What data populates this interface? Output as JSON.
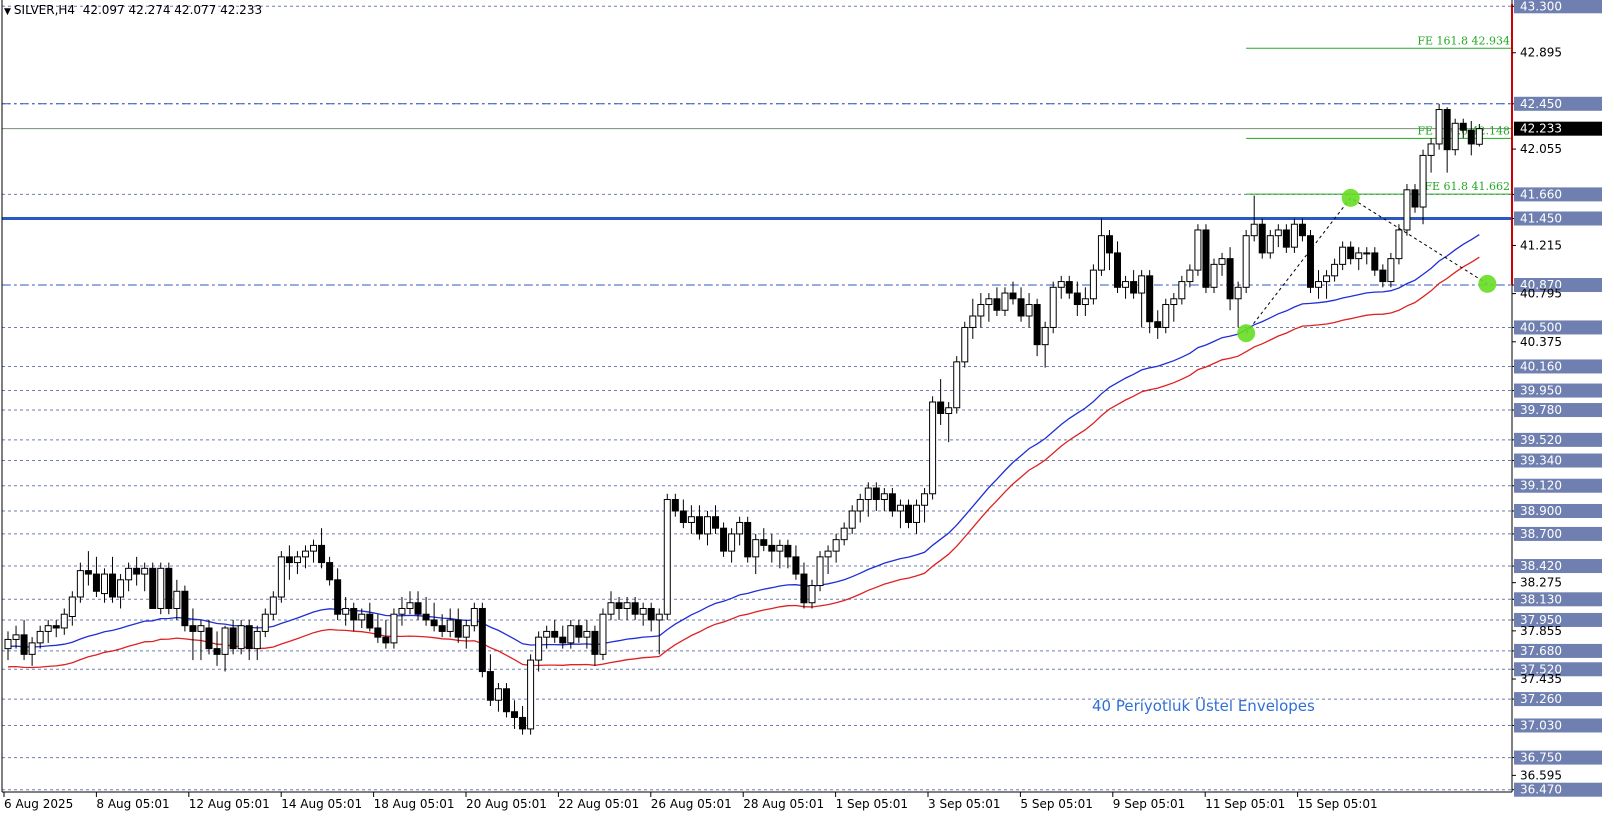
{
  "header": {
    "symbol": "SILVER,H4",
    "ohlc": "42.097 42.274 42.077 42.233"
  },
  "annotation": "40 Periyotluk Üstel Envelopes",
  "chart_data": {
    "type": "candlestick",
    "ylim": [
      36.45,
      43.32
    ],
    "current_price": 42.233,
    "price_axis_labels": [
      43.3,
      42.895,
      42.45,
      42.055,
      41.66,
      41.45,
      41.215,
      40.87,
      40.795,
      40.5,
      40.375,
      40.16,
      39.95,
      39.78,
      39.52,
      39.34,
      39.12,
      38.9,
      38.7,
      38.42,
      38.275,
      38.13,
      37.95,
      37.855,
      37.68,
      37.52,
      37.435,
      37.26,
      37.03,
      36.75,
      36.595,
      36.47
    ],
    "highlighted_levels": [
      43.3,
      42.45,
      41.66,
      41.45,
      40.87,
      40.5,
      40.16,
      39.95,
      39.78,
      39.52,
      39.34,
      39.12,
      38.9,
      38.7,
      38.42,
      38.13,
      37.95,
      37.68,
      37.52,
      37.26,
      37.03,
      36.75,
      36.47
    ],
    "time_labels": [
      "6 Aug 2025",
      "8 Aug 05:01",
      "12 Aug 05:01",
      "14 Aug 05:01",
      "18 Aug 05:01",
      "20 Aug 05:01",
      "22 Aug 05:01",
      "26 Aug 05:01",
      "28 Aug 05:01",
      "1 Sep 05:01",
      "3 Sep 05:01",
      "5 Sep 05:01",
      "9 Sep 05:01",
      "11 Sep 05:01",
      "15 Sep 05:01"
    ],
    "support_line": 41.45,
    "dash_dot_levels": [
      42.45,
      40.87
    ],
    "fibonacci": [
      {
        "label": "FE 161.8 42.934",
        "value": 42.934
      },
      {
        "label": "FE 100.0 42.148",
        "value": 42.148
      },
      {
        "label": "FE 61.8 41.662",
        "value": 41.662
      }
    ],
    "pattern_points": [
      {
        "index": 154,
        "price": 40.45
      },
      {
        "index": 167,
        "price": 41.63
      },
      {
        "index": 184,
        "price": 40.88
      }
    ],
    "candles": [
      [
        37.7,
        37.85,
        37.6,
        37.78
      ],
      [
        37.78,
        37.9,
        37.7,
        37.82
      ],
      [
        37.82,
        37.95,
        37.6,
        37.65
      ],
      [
        37.65,
        37.8,
        37.55,
        37.75
      ],
      [
        37.75,
        37.9,
        37.7,
        37.85
      ],
      [
        37.85,
        37.95,
        37.75,
        37.9
      ],
      [
        37.9,
        37.95,
        37.8,
        37.88
      ],
      [
        37.88,
        38.05,
        37.82,
        38.0
      ],
      [
        37.98,
        38.2,
        37.9,
        38.15
      ],
      [
        38.15,
        38.45,
        38.1,
        38.38
      ],
      [
        38.38,
        38.55,
        38.25,
        38.35
      ],
      [
        38.35,
        38.5,
        38.15,
        38.2
      ],
      [
        38.18,
        38.4,
        38.1,
        38.35
      ],
      [
        38.35,
        38.5,
        38.1,
        38.15
      ],
      [
        38.15,
        38.35,
        38.05,
        38.3
      ],
      [
        38.3,
        38.45,
        38.2,
        38.4
      ],
      [
        38.4,
        38.5,
        38.25,
        38.35
      ],
      [
        38.35,
        38.45,
        38.2,
        38.4
      ],
      [
        38.4,
        38.45,
        38.05,
        38.05
      ],
      [
        38.05,
        38.45,
        38.0,
        38.4
      ],
      [
        38.4,
        38.45,
        38.0,
        38.05
      ],
      [
        38.05,
        38.3,
        37.95,
        38.2
      ],
      [
        38.2,
        38.25,
        37.85,
        37.9
      ],
      [
        37.9,
        38.05,
        37.6,
        37.85
      ],
      [
        37.85,
        37.95,
        37.6,
        37.9
      ],
      [
        37.88,
        37.95,
        37.65,
        37.7
      ],
      [
        37.7,
        37.85,
        37.55,
        37.65
      ],
      [
        37.65,
        37.9,
        37.5,
        37.88
      ],
      [
        37.88,
        37.95,
        37.65,
        37.7
      ],
      [
        37.7,
        37.95,
        37.65,
        37.9
      ],
      [
        37.9,
        37.95,
        37.6,
        37.7
      ],
      [
        37.7,
        37.9,
        37.6,
        37.85
      ],
      [
        37.85,
        38.05,
        37.8,
        38.0
      ],
      [
        38.0,
        38.2,
        37.95,
        38.15
      ],
      [
        38.15,
        38.55,
        38.1,
        38.5
      ],
      [
        38.5,
        38.6,
        38.3,
        38.45
      ],
      [
        38.45,
        38.55,
        38.35,
        38.5
      ],
      [
        38.5,
        38.6,
        38.4,
        38.55
      ],
      [
        38.55,
        38.65,
        38.45,
        38.6
      ],
      [
        38.6,
        38.75,
        38.4,
        38.45
      ],
      [
        38.45,
        38.5,
        38.25,
        38.3
      ],
      [
        38.3,
        38.4,
        37.95,
        38.0
      ],
      [
        38.0,
        38.15,
        37.9,
        38.05
      ],
      [
        38.05,
        38.1,
        37.85,
        37.95
      ],
      [
        37.95,
        38.05,
        37.88,
        38.0
      ],
      [
        38.0,
        38.1,
        37.85,
        37.88
      ],
      [
        37.88,
        38.0,
        37.75,
        37.8
      ],
      [
        37.8,
        37.95,
        37.7,
        37.75
      ],
      [
        37.75,
        38.05,
        37.7,
        38.0
      ],
      [
        38.0,
        38.15,
        37.9,
        38.05
      ],
      [
        38.05,
        38.2,
        38.0,
        38.1
      ],
      [
        38.1,
        38.2,
        37.95,
        38.0
      ],
      [
        38.0,
        38.15,
        37.9,
        37.95
      ],
      [
        37.95,
        38.1,
        37.85,
        37.9
      ],
      [
        37.9,
        38.0,
        37.8,
        37.85
      ],
      [
        37.85,
        38.05,
        37.8,
        37.95
      ],
      [
        37.95,
        38.05,
        37.75,
        37.8
      ],
      [
        37.8,
        37.95,
        37.7,
        37.9
      ],
      [
        37.9,
        38.1,
        37.85,
        38.05
      ],
      [
        38.05,
        38.1,
        37.45,
        37.5
      ],
      [
        37.5,
        37.65,
        37.2,
        37.25
      ],
      [
        37.25,
        37.4,
        37.15,
        37.35
      ],
      [
        37.35,
        37.4,
        37.1,
        37.15
      ],
      [
        37.15,
        37.25,
        37.0,
        37.1
      ],
      [
        37.1,
        37.2,
        36.95,
        37.0
      ],
      [
        37.0,
        37.65,
        36.95,
        37.6
      ],
      [
        37.6,
        37.85,
        37.5,
        37.8
      ],
      [
        37.8,
        37.9,
        37.7,
        37.85
      ],
      [
        37.85,
        37.95,
        37.75,
        37.8
      ],
      [
        37.8,
        37.9,
        37.7,
        37.75
      ],
      [
        37.75,
        37.95,
        37.7,
        37.9
      ],
      [
        37.9,
        37.95,
        37.75,
        37.8
      ],
      [
        37.8,
        37.95,
        37.7,
        37.85
      ],
      [
        37.85,
        37.9,
        37.55,
        37.65
      ],
      [
        37.65,
        38.05,
        37.6,
        38.0
      ],
      [
        38.0,
        38.2,
        37.95,
        38.1
      ],
      [
        38.1,
        38.15,
        37.95,
        38.05
      ],
      [
        38.05,
        38.15,
        37.95,
        38.1
      ],
      [
        38.1,
        38.15,
        37.95,
        38.0
      ],
      [
        38.0,
        38.1,
        37.9,
        38.05
      ],
      [
        38.05,
        38.1,
        37.85,
        37.95
      ],
      [
        37.95,
        38.05,
        37.65,
        38.0
      ],
      [
        38.0,
        39.05,
        37.95,
        39.0
      ],
      [
        39.0,
        39.05,
        38.85,
        38.9
      ],
      [
        38.9,
        39.0,
        38.75,
        38.8
      ],
      [
        38.8,
        38.95,
        38.7,
        38.85
      ],
      [
        38.85,
        38.95,
        38.65,
        38.7
      ],
      [
        38.7,
        38.9,
        38.6,
        38.85
      ],
      [
        38.85,
        38.95,
        38.7,
        38.75
      ],
      [
        38.75,
        38.8,
        38.5,
        38.55
      ],
      [
        38.55,
        38.75,
        38.45,
        38.7
      ],
      [
        38.7,
        38.85,
        38.6,
        38.8
      ],
      [
        38.8,
        38.85,
        38.45,
        38.5
      ],
      [
        38.5,
        38.7,
        38.35,
        38.65
      ],
      [
        38.65,
        38.75,
        38.55,
        38.6
      ],
      [
        38.6,
        38.7,
        38.45,
        38.55
      ],
      [
        38.55,
        38.65,
        38.4,
        38.6
      ],
      [
        38.6,
        38.65,
        38.4,
        38.5
      ],
      [
        38.5,
        38.6,
        38.3,
        38.35
      ],
      [
        38.35,
        38.45,
        38.05,
        38.1
      ],
      [
        38.1,
        38.3,
        38.05,
        38.25
      ],
      [
        38.25,
        38.55,
        38.2,
        38.5
      ],
      [
        38.5,
        38.6,
        38.35,
        38.55
      ],
      [
        38.55,
        38.7,
        38.45,
        38.65
      ],
      [
        38.65,
        38.8,
        38.6,
        38.75
      ],
      [
        38.75,
        38.95,
        38.7,
        38.9
      ],
      [
        38.9,
        39.05,
        38.8,
        39.0
      ],
      [
        39.0,
        39.15,
        38.85,
        39.1
      ],
      [
        39.1,
        39.15,
        38.9,
        39.0
      ],
      [
        39.0,
        39.1,
        38.9,
        39.05
      ],
      [
        39.05,
        39.1,
        38.85,
        38.9
      ],
      [
        38.9,
        39.0,
        38.75,
        38.95
      ],
      [
        38.95,
        39.0,
        38.75,
        38.8
      ],
      [
        38.8,
        39.0,
        38.7,
        38.95
      ],
      [
        38.95,
        39.1,
        38.8,
        39.05
      ],
      [
        39.05,
        39.9,
        39.0,
        39.85
      ],
      [
        39.85,
        40.05,
        39.65,
        39.75
      ],
      [
        39.75,
        39.85,
        39.5,
        39.8
      ],
      [
        39.8,
        40.25,
        39.75,
        40.2
      ],
      [
        40.2,
        40.55,
        40.15,
        40.5
      ],
      [
        40.5,
        40.75,
        40.4,
        40.6
      ],
      [
        40.6,
        40.8,
        40.5,
        40.7
      ],
      [
        40.7,
        40.8,
        40.55,
        40.75
      ],
      [
        40.75,
        40.85,
        40.6,
        40.65
      ],
      [
        40.65,
        40.85,
        40.6,
        40.8
      ],
      [
        40.8,
        40.9,
        40.7,
        40.75
      ],
      [
        40.75,
        40.85,
        40.55,
        40.6
      ],
      [
        40.6,
        40.8,
        40.5,
        40.7
      ],
      [
        40.7,
        40.75,
        40.25,
        40.35
      ],
      [
        40.35,
        40.55,
        40.15,
        40.5
      ],
      [
        40.5,
        40.9,
        40.45,
        40.85
      ],
      [
        40.85,
        40.95,
        40.75,
        40.9
      ],
      [
        40.9,
        40.95,
        40.75,
        40.8
      ],
      [
        40.8,
        40.9,
        40.6,
        40.7
      ],
      [
        40.7,
        40.85,
        40.6,
        40.75
      ],
      [
        40.75,
        41.05,
        40.7,
        41.0
      ],
      [
        41.0,
        41.45,
        40.95,
        41.3
      ],
      [
        41.3,
        41.35,
        41.0,
        41.15
      ],
      [
        41.15,
        41.25,
        40.8,
        40.85
      ],
      [
        40.85,
        40.95,
        40.75,
        40.9
      ],
      [
        40.9,
        41.0,
        40.75,
        40.8
      ],
      [
        40.8,
        41.0,
        40.5,
        40.95
      ],
      [
        40.95,
        41.0,
        40.45,
        40.55
      ],
      [
        40.55,
        40.65,
        40.4,
        40.5
      ],
      [
        40.5,
        40.75,
        40.45,
        40.7
      ],
      [
        40.7,
        40.8,
        40.55,
        40.75
      ],
      [
        40.75,
        40.95,
        40.7,
        40.9
      ],
      [
        40.9,
        41.05,
        40.85,
        41.0
      ],
      [
        41.0,
        41.4,
        40.95,
        41.35
      ],
      [
        41.35,
        41.4,
        40.8,
        40.85
      ],
      [
        40.85,
        41.1,
        40.8,
        41.05
      ],
      [
        41.05,
        41.15,
        40.95,
        41.1
      ],
      [
        41.1,
        41.2,
        40.65,
        40.75
      ],
      [
        40.75,
        40.9,
        40.5,
        40.85
      ],
      [
        40.85,
        41.35,
        40.8,
        41.3
      ],
      [
        41.3,
        41.65,
        41.25,
        41.4
      ],
      [
        41.4,
        41.45,
        41.1,
        41.15
      ],
      [
        41.15,
        41.35,
        41.1,
        41.3
      ],
      [
        41.3,
        41.4,
        41.2,
        41.35
      ],
      [
        41.35,
        41.4,
        41.15,
        41.2
      ],
      [
        41.2,
        41.45,
        41.15,
        41.4
      ],
      [
        41.4,
        41.45,
        41.25,
        41.3
      ],
      [
        41.3,
        41.35,
        40.8,
        40.85
      ],
      [
        40.85,
        41.0,
        40.75,
        40.9
      ],
      [
        40.9,
        41.0,
        40.75,
        40.95
      ],
      [
        40.95,
        41.1,
        40.9,
        41.05
      ],
      [
        41.05,
        41.25,
        41.0,
        41.2
      ],
      [
        41.2,
        41.25,
        41.05,
        41.1
      ],
      [
        41.1,
        41.2,
        41.0,
        41.15
      ],
      [
        41.15,
        41.2,
        41.05,
        41.15
      ],
      [
        41.15,
        41.2,
        40.95,
        41.0
      ],
      [
        41.0,
        41.05,
        40.85,
        40.9
      ],
      [
        40.9,
        41.15,
        40.85,
        41.1
      ],
      [
        41.1,
        41.4,
        41.05,
        41.35
      ],
      [
        41.35,
        41.75,
        41.3,
        41.7
      ],
      [
        41.7,
        41.75,
        41.5,
        41.55
      ],
      [
        41.55,
        42.05,
        41.4,
        42.0
      ],
      [
        42.0,
        42.15,
        41.85,
        42.1
      ],
      [
        42.1,
        42.45,
        42.05,
        42.4
      ],
      [
        42.4,
        42.42,
        41.85,
        42.05
      ],
      [
        42.05,
        42.32,
        42.0,
        42.28
      ],
      [
        42.28,
        42.32,
        42.15,
        42.22
      ],
      [
        42.22,
        42.3,
        42.0,
        42.1
      ],
      [
        42.097,
        42.274,
        42.077,
        42.233
      ]
    ]
  }
}
